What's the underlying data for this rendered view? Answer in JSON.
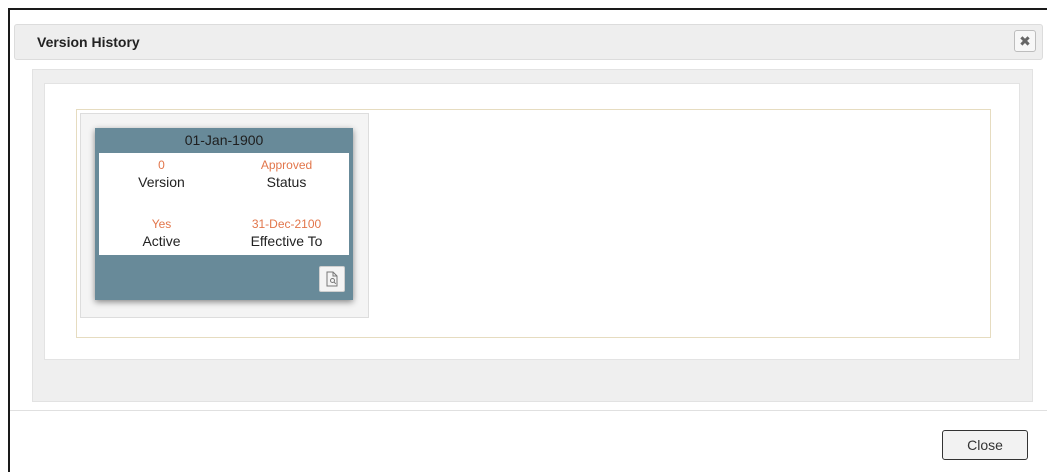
{
  "dialog": {
    "title": "Version History",
    "close_icon_glyph": "✖",
    "close_button_label": "Close"
  },
  "versions": [
    {
      "date": "01-Jan-1900",
      "version_value": "0",
      "version_label": "Version",
      "status_value": "Approved",
      "status_label": "Status",
      "active_value": "Yes",
      "active_label": "Active",
      "effective_to_value": "31-Dec-2100",
      "effective_to_label": "Effective To",
      "action_icon": "document-preview-icon"
    }
  ],
  "colors": {
    "card_header": "#688a99",
    "value_text": "#e2764b"
  }
}
